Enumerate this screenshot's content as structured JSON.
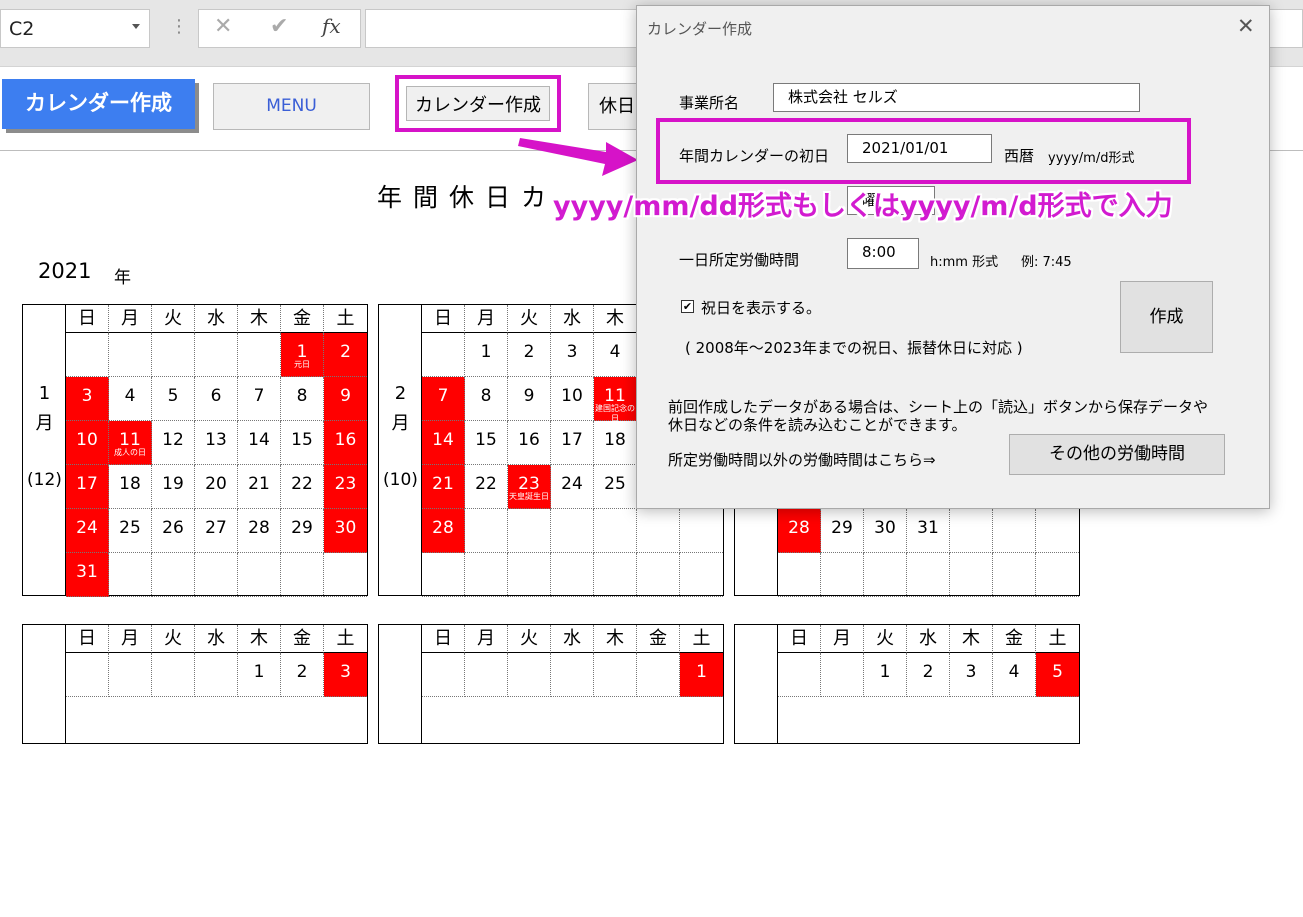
{
  "formula_bar": {
    "cell_ref": "C2",
    "fx": "fx",
    "cancel": "✕",
    "enter": "✔"
  },
  "toolbar": {
    "title": "カレンダー作成",
    "menu": "MENU",
    "create_calendar": "カレンダー作成",
    "holiday": "休日"
  },
  "sheet": {
    "title": "年間休日カ",
    "year": "2021",
    "year_unit": "年"
  },
  "weekdays": [
    "日",
    "月",
    "火",
    "水",
    "木",
    "金",
    "土"
  ],
  "months": [
    {
      "num": "1",
      "unit": "月",
      "count": "(12)",
      "rows": [
        [
          "",
          "",
          "",
          "",
          "",
          "1",
          "2"
        ],
        [
          "3",
          "4",
          "5",
          "6",
          "7",
          "8",
          "9"
        ],
        [
          "10",
          "11",
          "12",
          "13",
          "14",
          "15",
          "16"
        ],
        [
          "17",
          "18",
          "19",
          "20",
          "21",
          "22",
          "23"
        ],
        [
          "24",
          "25",
          "26",
          "27",
          "28",
          "29",
          "30"
        ],
        [
          "31",
          "",
          "",
          "",
          "",
          "",
          ""
        ]
      ],
      "red": [
        [
          0,
          5
        ],
        [
          0,
          6
        ],
        [
          1,
          0
        ],
        [
          1,
          6
        ],
        [
          2,
          0
        ],
        [
          2,
          1
        ],
        [
          2,
          6
        ],
        [
          3,
          0
        ],
        [
          3,
          6
        ],
        [
          4,
          0
        ],
        [
          4,
          6
        ],
        [
          5,
          0
        ]
      ],
      "holidays": [
        {
          "r": 0,
          "c": 5,
          "t": "元日"
        },
        {
          "r": 2,
          "c": 1,
          "t": "成人の日"
        }
      ]
    },
    {
      "num": "2",
      "unit": "月",
      "count": "(10)",
      "rows": [
        [
          "",
          "1",
          "2",
          "3",
          "4",
          "",
          ""
        ],
        [
          "7",
          "8",
          "9",
          "10",
          "11",
          "",
          ""
        ],
        [
          "14",
          "15",
          "16",
          "17",
          "18",
          "",
          ""
        ],
        [
          "21",
          "22",
          "23",
          "24",
          "25",
          "",
          ""
        ],
        [
          "28",
          "",
          "",
          "",
          "",
          "",
          ""
        ],
        [
          "",
          "",
          "",
          "",
          "",
          "",
          ""
        ]
      ],
      "red": [
        [
          1,
          0
        ],
        [
          1,
          4
        ],
        [
          2,
          0
        ],
        [
          3,
          0
        ],
        [
          3,
          2
        ],
        [
          4,
          0
        ]
      ],
      "holidays": [
        {
          "r": 1,
          "c": 4,
          "t": "建国記念の日"
        },
        {
          "r": 3,
          "c": 2,
          "t": "天皇誕生日"
        }
      ]
    },
    {
      "num": "",
      "unit": "",
      "count": "",
      "rows": [
        [
          "",
          "",
          "",
          "",
          "",
          "",
          ""
        ],
        [
          "",
          "",
          "",
          "",
          "",
          "",
          ""
        ],
        [
          "",
          "",
          "",
          "",
          "",
          "",
          ""
        ],
        [
          "",
          "",
          "",
          "",
          "",
          "",
          ""
        ],
        [
          "28",
          "29",
          "30",
          "31",
          "",
          "",
          ""
        ],
        [
          "",
          "",
          "",
          "",
          "",
          "",
          ""
        ]
      ],
      "red": [
        [
          4,
          0
        ]
      ],
      "holidays": []
    },
    {
      "num": "",
      "unit": "",
      "count": "",
      "rows": [
        [
          "",
          "",
          "",
          "",
          "1",
          "2",
          "3"
        ]
      ],
      "red": [
        [
          0,
          6
        ]
      ],
      "holidays": []
    },
    {
      "num": "",
      "unit": "",
      "count": "",
      "rows": [
        [
          "",
          "",
          "",
          "",
          "",
          "",
          "1"
        ]
      ],
      "red": [
        [
          0,
          6
        ]
      ],
      "holidays": []
    },
    {
      "num": "",
      "unit": "",
      "count": "",
      "rows": [
        [
          "",
          "",
          "1",
          "2",
          "3",
          "4",
          "5"
        ]
      ],
      "red": [
        [
          0,
          6
        ]
      ],
      "holidays": []
    }
  ],
  "dialog": {
    "title": "カレンダー作成",
    "close": "✕",
    "office_label": "事業所名",
    "office_value": "株式会社 セルズ",
    "start_label": "年間カレンダーの初日",
    "start_value": "2021/01/01",
    "start_hint": "西暦",
    "start_format": "yyyy/m/d形式",
    "hidden_field_fragment": "曜",
    "hours_label": "一日所定労働時間",
    "hours_value": "8:00",
    "hours_format": "h:mm 形式",
    "hours_example": "例:  7:45",
    "holiday_checkbox": "祝日を表示する。",
    "holiday_checked": true,
    "create_button": "作成",
    "holiday_note": "( 2008年～2023年までの祝日、振替休日に対応 )",
    "load_note_1": "前回作成したデータがある場合は、シート上の「読込」ボタンから保存データや",
    "load_note_2": "休日などの条件を読み込むことができます。",
    "other_hours_label": "所定労働時間以外の労働時間はこちら⇒",
    "other_hours_button": "その他の労働時間"
  },
  "annotation": "yyyy/mm/dd形式もしくはyyyy/m/d形式で入力",
  "colors": {
    "highlight": "#d613c8",
    "holiday_red": "#ff0000",
    "title_button": "#3d7ef0",
    "annotation_text": "#d21bd0"
  }
}
